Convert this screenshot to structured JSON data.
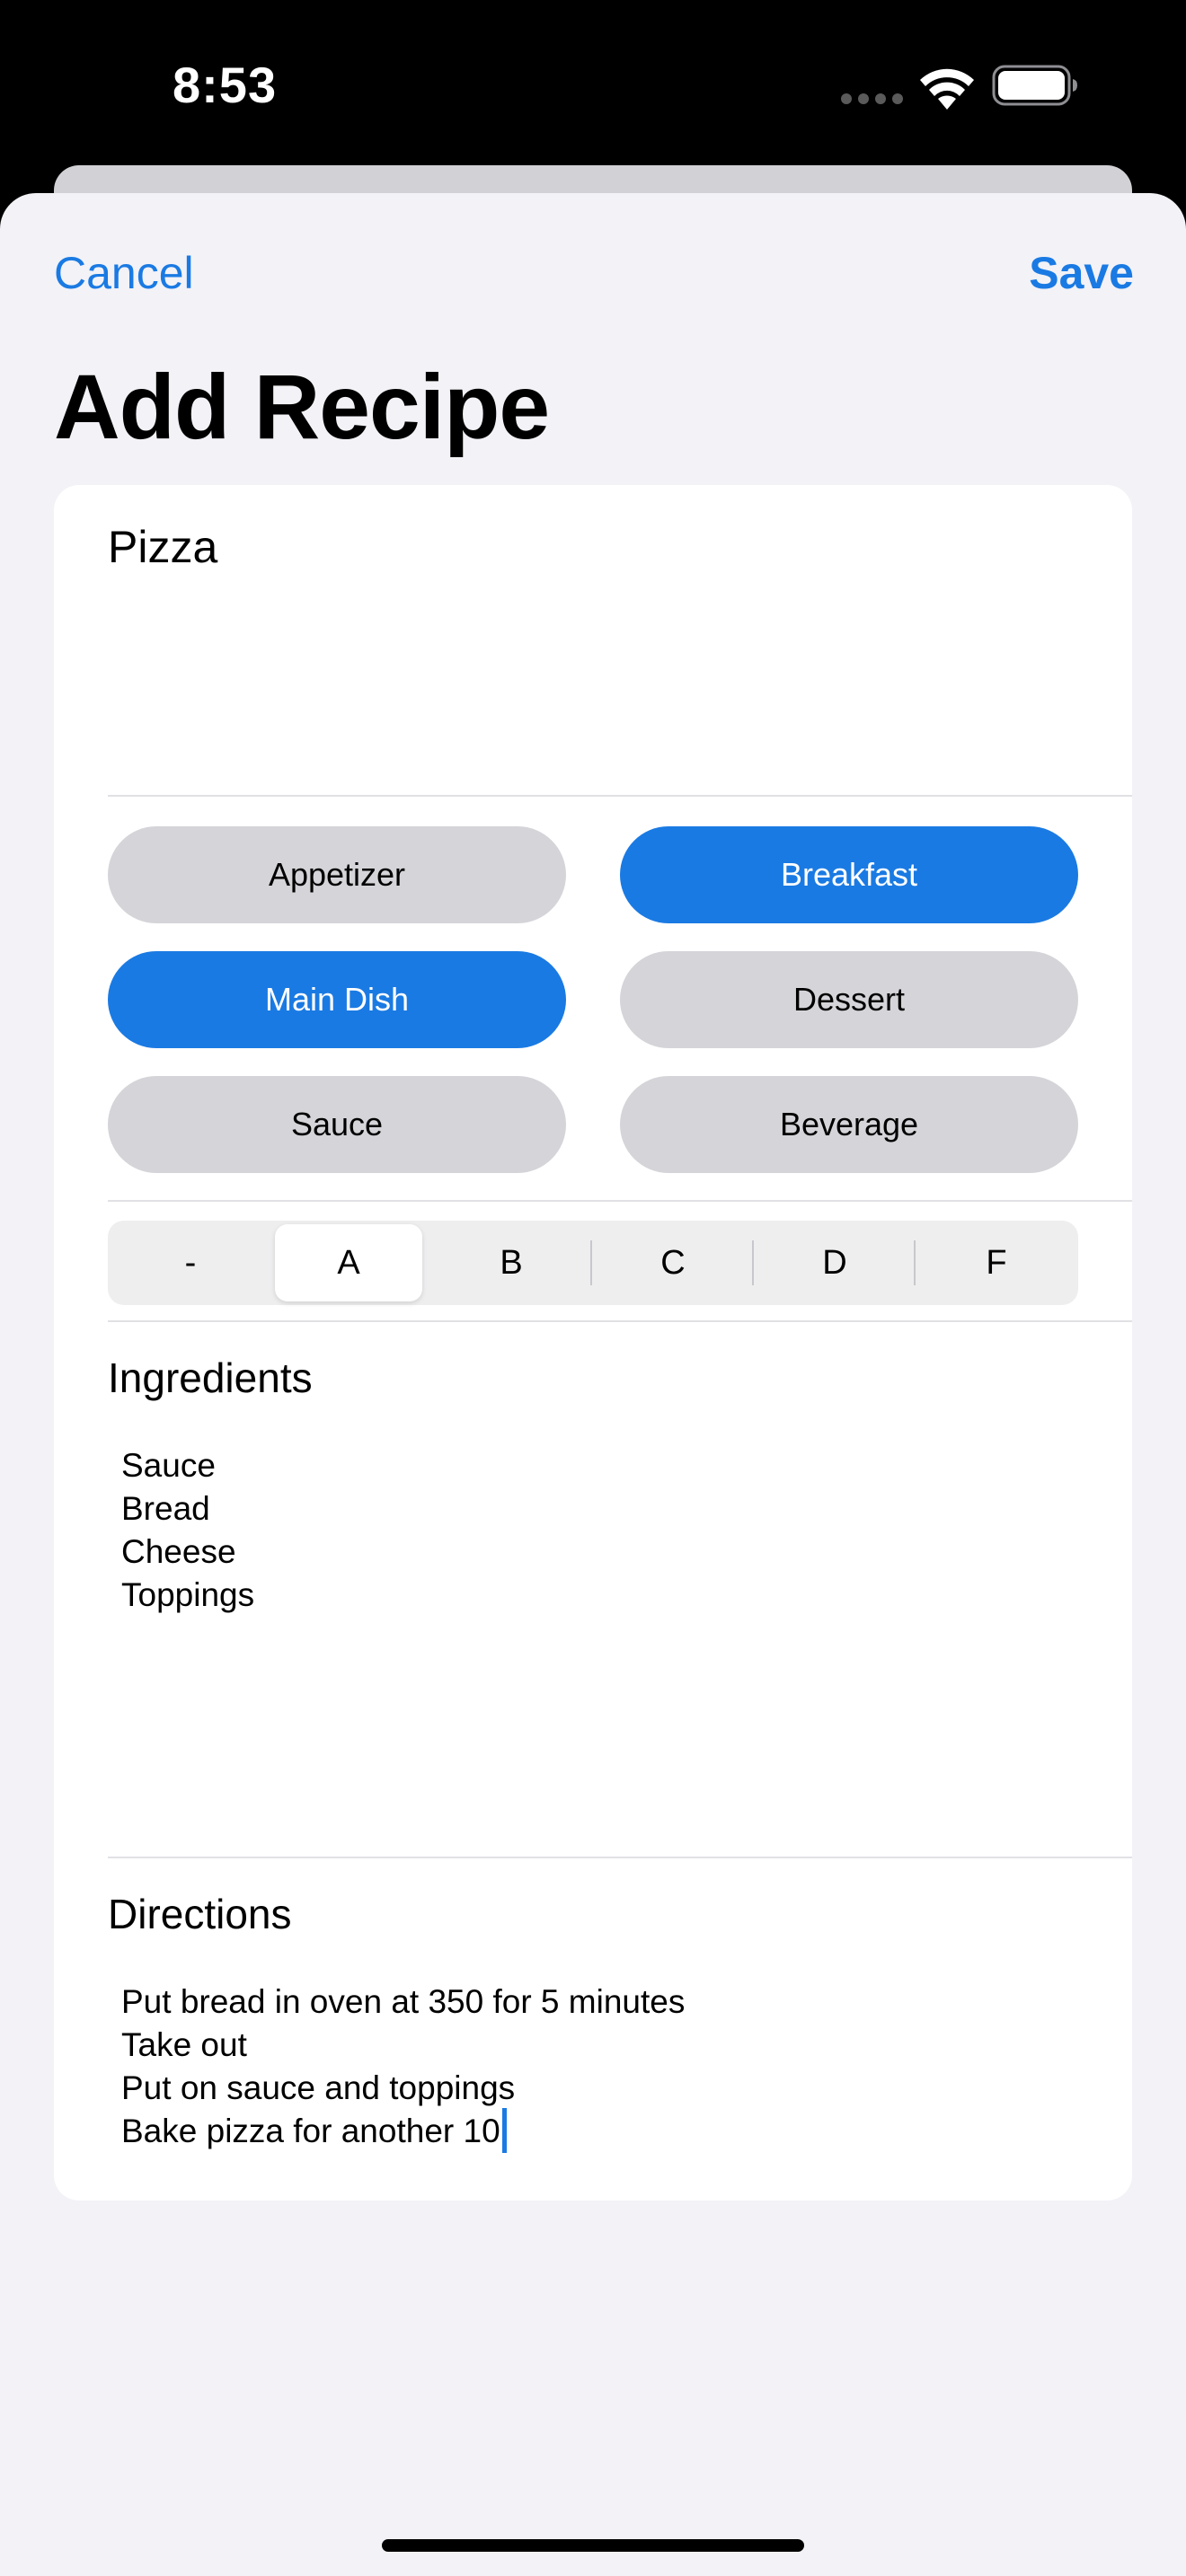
{
  "status_bar": {
    "time": "8:53",
    "icons": [
      "signal-dots-icon",
      "wifi-icon",
      "battery-icon"
    ]
  },
  "nav": {
    "cancel_label": "Cancel",
    "save_label": "Save"
  },
  "title": "Add Recipe",
  "recipe_name": "Pizza",
  "categories": [
    {
      "label": "Appetizer",
      "selected": false
    },
    {
      "label": "Breakfast",
      "selected": true
    },
    {
      "label": "Main Dish",
      "selected": true
    },
    {
      "label": "Dessert",
      "selected": false
    },
    {
      "label": "Sauce",
      "selected": false
    },
    {
      "label": "Beverage",
      "selected": false
    }
  ],
  "rating_segments": [
    "-",
    "A",
    "B",
    "C",
    "D",
    "F"
  ],
  "rating_selected": "A",
  "ingredients": {
    "label": "Ingredients",
    "lines": [
      "Sauce",
      "Bread",
      "Cheese",
      "Toppings"
    ]
  },
  "directions": {
    "label": "Directions",
    "lines": [
      "Put bread in oven at 350 for 5 minutes",
      "Take out",
      "Put on sauce and toppings",
      "Bake pizza for another 10"
    ]
  },
  "colors": {
    "accent": "#1a7ae3",
    "unselected_button": "#d4d4d9",
    "sheet_background": "#f2f2f7",
    "card_background": "#ffffff"
  }
}
